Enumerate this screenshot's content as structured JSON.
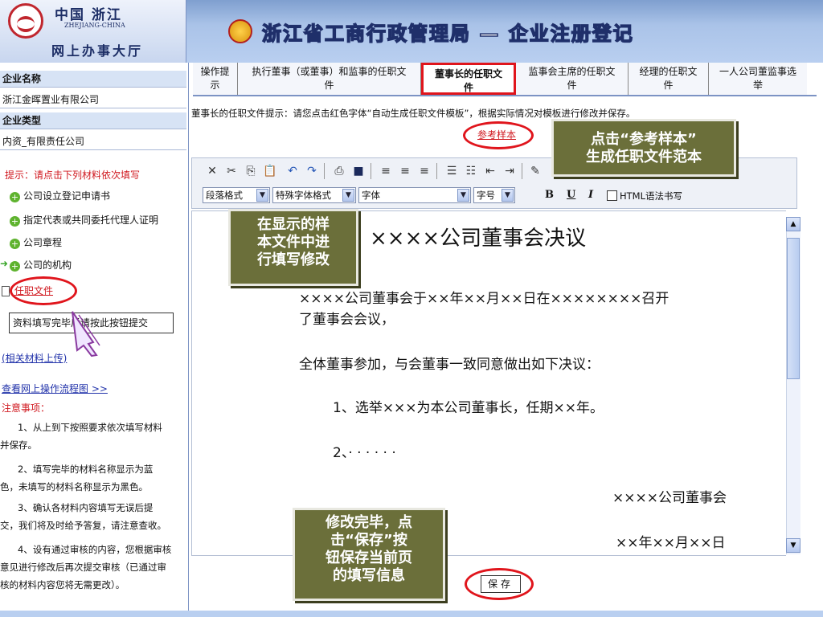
{
  "header": {
    "logo_cn": "中国 浙江",
    "logo_en": "ZHEJIANG-CHINA",
    "logo_hall": "网上办事大厅",
    "title": "浙江省工商行政管理局 — 企业注册登记"
  },
  "sidebar": {
    "company_name_label": "企业名称",
    "company_name_value": "浙江金晖置业有限公司",
    "company_type_label": "企业类型",
    "company_type_value": "内资_有限责任公司",
    "hint": "提示：请点击下列材料依次填写",
    "materials": [
      {
        "label": "公司设立登记申请书"
      },
      {
        "label": "指定代表或共同委托代理人证明"
      },
      {
        "label": "公司章程"
      },
      {
        "label": "公司的机构"
      }
    ],
    "current_item": "任职文件",
    "submit_tip": "资料填写完毕后请按此按钮提交",
    "related_upload": "(相关材料上传)",
    "flowchart_link": "查看网上操作流程图 >>",
    "notice_title": "注意事项：",
    "notes": [
      "1、从上到下按照要求依次填写材料",
      "并保存。",
      "2、填写完毕的材料名称显示为蓝",
      "色，未填写的材料名称显示为黑色。",
      "3、确认各材料内容填写无误后提",
      "交，我们将及时给予答复，请注意查收。",
      "4、设有通过审核的内容，您根据审核",
      "意见进行修改后再次提交审核（已通过审",
      "核的材料内容您将无需更改）。"
    ]
  },
  "tabs": [
    {
      "line1": "操作提",
      "line2": "示"
    },
    {
      "line1": "执行董事（或董事）和监事的任职文",
      "line2": "件"
    },
    {
      "line1": "董事长的任职文",
      "line2": "件"
    },
    {
      "line1": "监事会主席的任职文",
      "line2": "件"
    },
    {
      "line1": "经理的任职文",
      "line2": "件"
    },
    {
      "line1": "一人公司董监事选",
      "line2": "举"
    }
  ],
  "main": {
    "hint_line": "董事长的任职文件提示：请您点击红色字体“自动生成任职文件模板”，根据实际情况对模板进行修改并保存。",
    "sample_link": "参考样本",
    "save_label": "保存"
  },
  "toolbar": {
    "icons": [
      "cut-icon",
      "copy-icon",
      "paste-icon",
      "paste-word-icon",
      "undo-icon",
      "redo-icon",
      "print-icon",
      "save-disk-icon",
      "align-left-icon",
      "align-center-icon",
      "align-right-icon",
      "ordered-list-icon",
      "unordered-list-icon",
      "outdent-icon",
      "indent-icon",
      "insert-image-icon"
    ],
    "glyphs": [
      "✕",
      "✂",
      "⎘",
      "📋",
      "↶",
      "↷",
      "⎙",
      "■",
      "≡",
      "≡",
      "≡",
      "☰",
      "☷",
      "⇤",
      "⇥",
      "✎"
    ],
    "paragraph_format": "段落格式",
    "special_format": "特殊字体格式",
    "font": "字体",
    "font_size": "字号",
    "bold": "B",
    "underline": "U",
    "italic": "I",
    "html_mode": "HTML语法书写"
  },
  "document": {
    "title": "××××公司董事会决议",
    "para1_line1": "××××公司董事会于××年××月××日在××××××××召开",
    "para1_line2": "了董事会会议，",
    "para2": "全体董事参加，与会董事一致同意做出如下决议：",
    "item1": "1、选举×××为本公司董事长，任期××年。",
    "item2": "2、· · · · · ·",
    "signature": "××××公司董事会",
    "date": "××年××月××日"
  },
  "callouts": {
    "sample": "点击“参考样本”生成任职文件范本",
    "sample_line1": "点击“参考样本”",
    "sample_line2": "生成任职文件范本",
    "edit_line1": "在显示的样",
    "edit_line2": "本文件中进",
    "edit_line3": "行填写修改",
    "save_line1": "修改完毕，点",
    "save_line2": "击“保存”按",
    "save_line3": "钮保存当前页",
    "save_line4": "的填写信息"
  },
  "colors": {
    "accent_red": "#e0151c",
    "callout_bg": "#6b6f3a",
    "header_blue": "#aac3e8"
  }
}
